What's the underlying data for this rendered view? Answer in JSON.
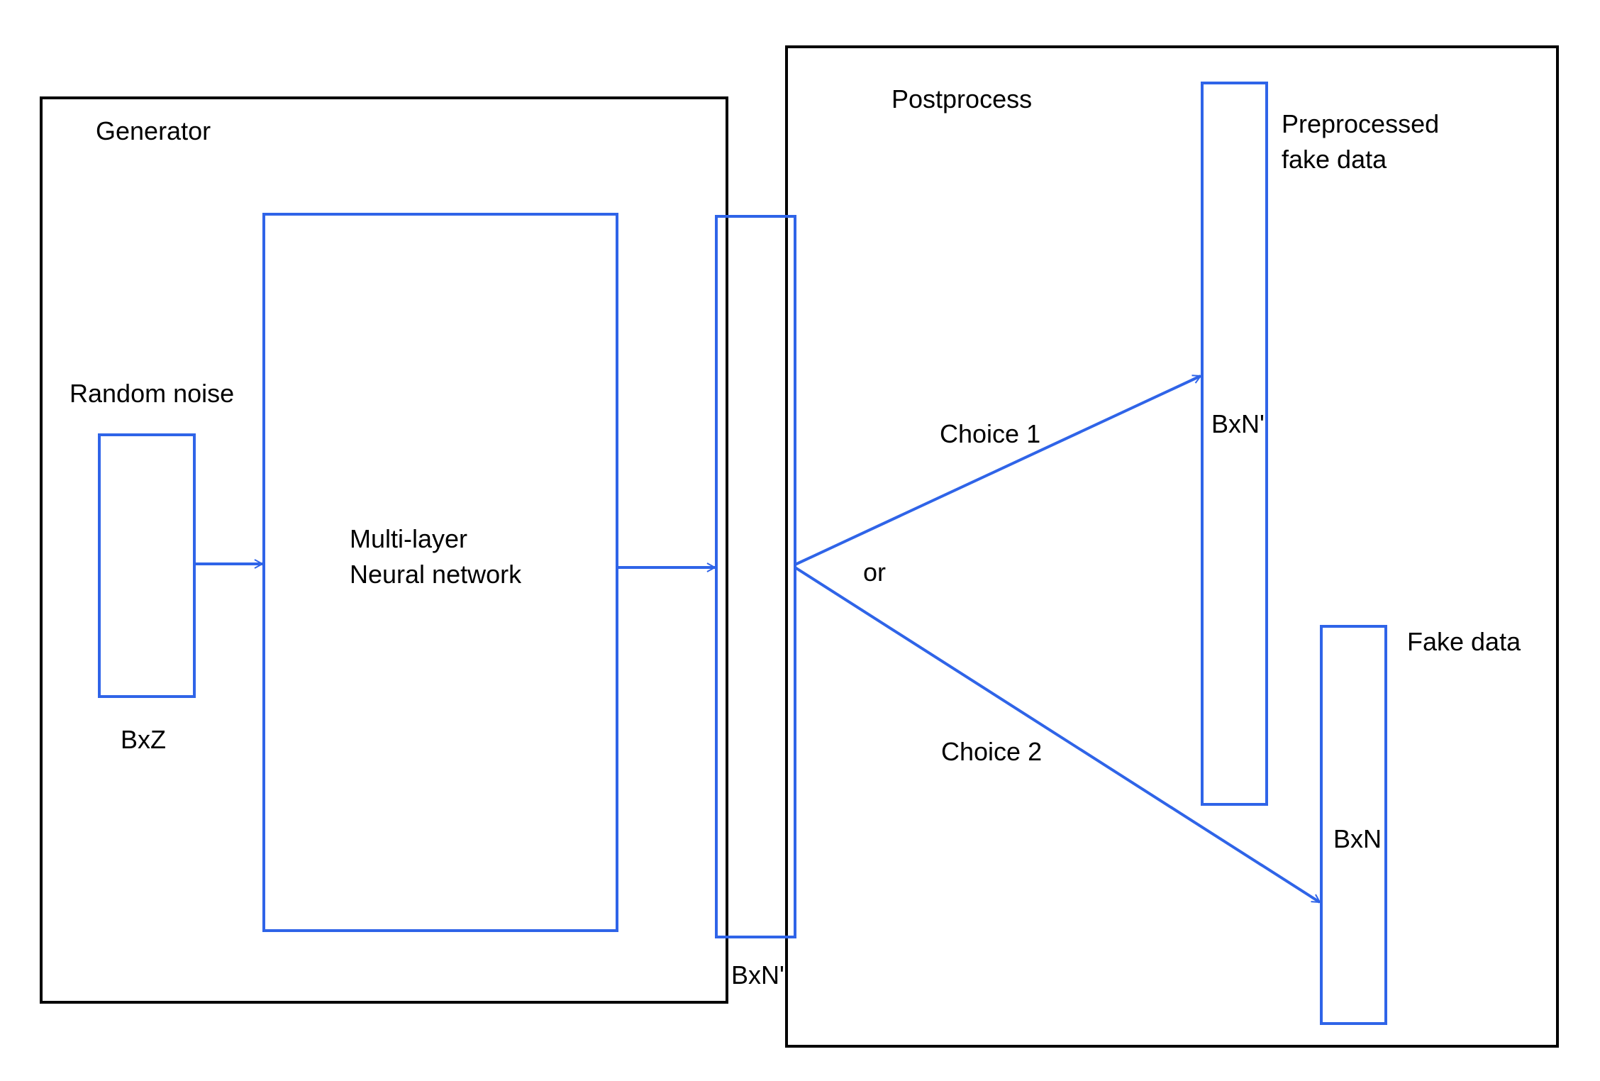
{
  "labels": {
    "generator": "Generator",
    "postprocess": "Postprocess",
    "random_noise": "Random noise",
    "bxz": "BxZ",
    "nn_line1": "Multi-layer",
    "nn_line2": "Neural network",
    "bxn_prime_bottom": "BxN'",
    "choice1": "Choice 1",
    "choice2": "Choice 2",
    "or": "or",
    "preprocessed_line1": "Preprocessed",
    "preprocessed_line2": "fake data",
    "bxn_prime_right": "BxN'",
    "fake_data": "Fake data",
    "bxn": "BxN"
  },
  "colors": {
    "frame": "#000000",
    "block": "#2f64e8",
    "text": "#000000",
    "background": "#ffffff"
  }
}
